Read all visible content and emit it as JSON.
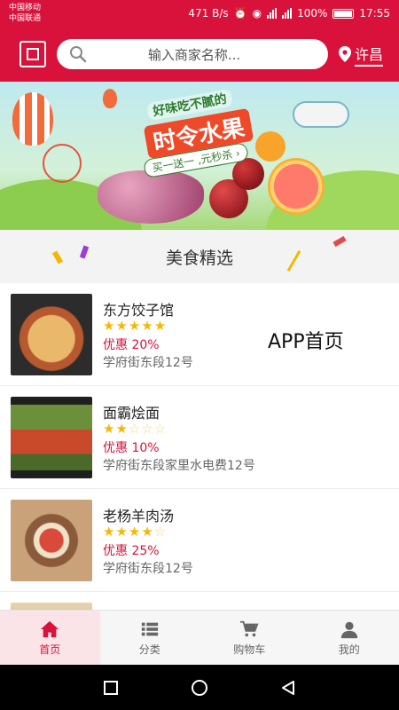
{
  "status_bar": {
    "carrier_1": "中国移动",
    "carrier_2": "中国联通",
    "speed": "471 B/s",
    "battery": "100%",
    "time": "17:55"
  },
  "header": {
    "scan_icon": "qr-scan-icon",
    "search_placeholder": "输入商家名称...",
    "location_icon": "map-pin-icon",
    "city": "许昌",
    "background_color": "#d8123a"
  },
  "banner": {
    "line1": "好味吃不腻的",
    "line2": "时令水果",
    "line3": "买一送一 ,元秒杀 ›"
  },
  "section": {
    "title": "美食精选"
  },
  "overlay_label": "APP首页",
  "restaurants": [
    {
      "name": "东方饺子馆",
      "rating": 4.5,
      "stars_on": "★★★★★",
      "stars_off": "",
      "discount": "优惠 20%",
      "address": "学府街东段12号"
    },
    {
      "name": "面霸烩面",
      "rating": 1.5,
      "stars_on": "★★",
      "stars_off": "☆☆☆",
      "discount": "优惠 10%",
      "address": "学府街东段家里水电费12号"
    },
    {
      "name": "老杨羊肉汤",
      "rating": 4,
      "stars_on": "★★★★",
      "stars_off": "☆",
      "discount": "优惠 25%",
      "address": "学府街东段12号"
    },
    {
      "name": "",
      "rating": 0,
      "stars_on": "",
      "stars_off": "",
      "discount": "",
      "address": ""
    }
  ],
  "tabs": [
    {
      "label": "首页",
      "icon": "home-icon",
      "active": true
    },
    {
      "label": "分类",
      "icon": "list-icon",
      "active": false
    },
    {
      "label": "购物车",
      "icon": "cart-icon",
      "active": false
    },
    {
      "label": "我的",
      "icon": "user-icon",
      "active": false
    }
  ],
  "nav_buttons": [
    "recents-icon",
    "home-circle-icon",
    "back-triangle-icon"
  ]
}
